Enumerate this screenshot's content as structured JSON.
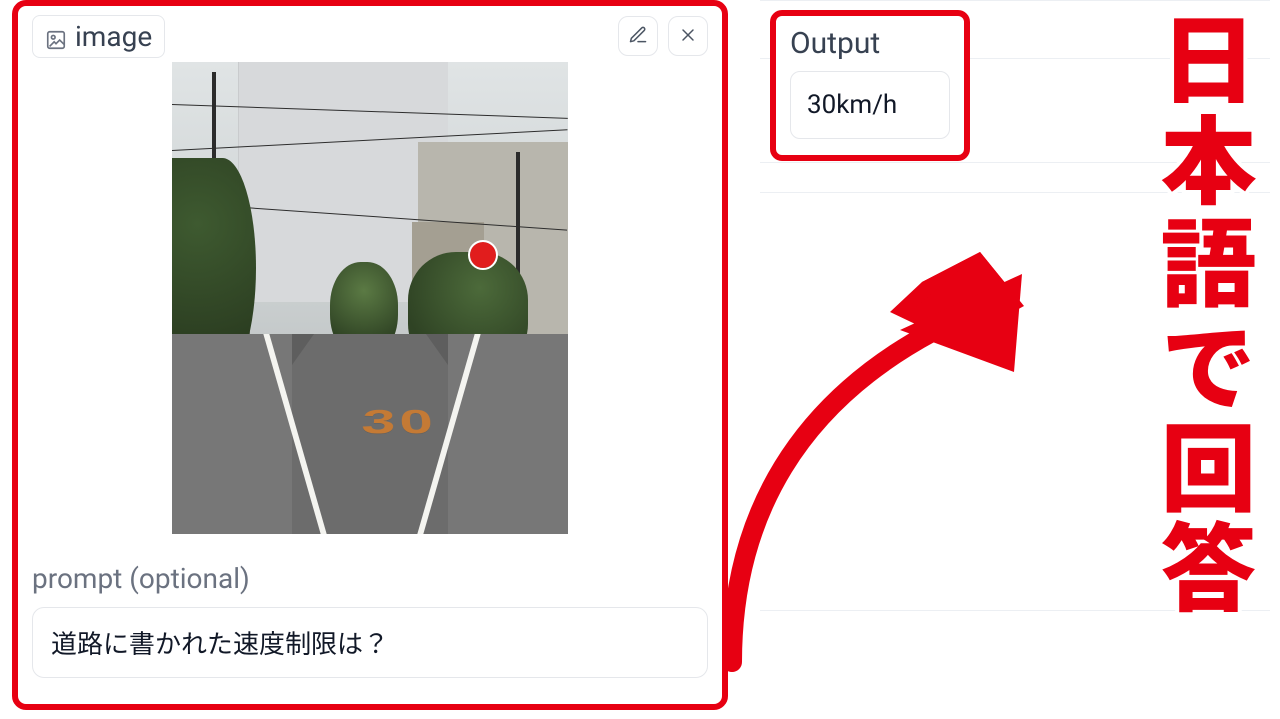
{
  "input": {
    "image_tab_label": "image",
    "road_limit_marking": "30",
    "prompt_label": "prompt (optional)",
    "prompt_value": "道路に書かれた速度制限は？"
  },
  "output": {
    "title": "Output",
    "value": "30km/h"
  },
  "annotation": {
    "caption": "日本語で回答"
  },
  "icons": {
    "image": "image-icon",
    "edit": "pencil-icon",
    "close": "close-icon"
  }
}
